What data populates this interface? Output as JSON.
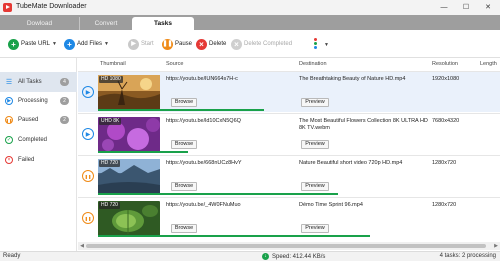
{
  "window": {
    "title": "TubeMate Downloader"
  },
  "tabs": [
    {
      "label": "Dowload"
    },
    {
      "label": "Convert"
    },
    {
      "label": "Tasks"
    }
  ],
  "toolbar": {
    "paste_url": "Paste URL",
    "add_files": "Add Files",
    "start": "Start",
    "pause": "Pause",
    "delete": "Delete",
    "delete_completed": "Delete Completed"
  },
  "sidebar": {
    "items": [
      {
        "label": "All Tasks",
        "count": "4"
      },
      {
        "label": "Processing",
        "count": "2"
      },
      {
        "label": "Paused",
        "count": "2"
      },
      {
        "label": "Completed",
        "count": ""
      },
      {
        "label": "Failed",
        "count": ""
      }
    ]
  },
  "table": {
    "columns": {
      "thumbnail": "Thumbnail",
      "source": "Source",
      "destination": "Destination",
      "resolution": "Resolution",
      "length": "Length"
    },
    "browse_label": "Browse",
    "preview_label": "Preview",
    "rows": [
      {
        "badge": "HD 1080",
        "source": "https://youtu.be/lUN664s7H-c",
        "destination": "The Breathtaking Beauty of Nature  HD.mp4",
        "resolution": "1920x1080",
        "progress": 0.52,
        "state": "processing"
      },
      {
        "badge": "UHD 8K",
        "source": "https://youtu.be/ld10CxN5Q6Q",
        "destination": "The Most Beautiful Flowers Collection 8K ULTRA HD 8K TV.webm",
        "resolution": "7680x4320",
        "progress": 0.28,
        "state": "processing"
      },
      {
        "badge": "HD 720",
        "source": "https://youtu.be/668nUCz8HvY",
        "destination": "Nature Beautiful short video 720p HD.mp4",
        "resolution": "1280x720",
        "progress": 0.75,
        "state": "paused"
      },
      {
        "badge": "HD 720",
        "source": "https://youtu.be/_4W0FNuMuo",
        "destination": "Démo Time Sprint 96.mp4",
        "resolution": "1280x720",
        "progress": 0.85,
        "state": "paused"
      }
    ]
  },
  "status": {
    "left": "Ready",
    "speed": "Speed: 412.44 KB/s",
    "right": "4 tasks: 2 processing"
  },
  "colors": {
    "accent_green": "#19a14a",
    "pause_orange": "#ef8a17",
    "delete_red": "#e53935",
    "play_blue": "#1e88e5"
  }
}
